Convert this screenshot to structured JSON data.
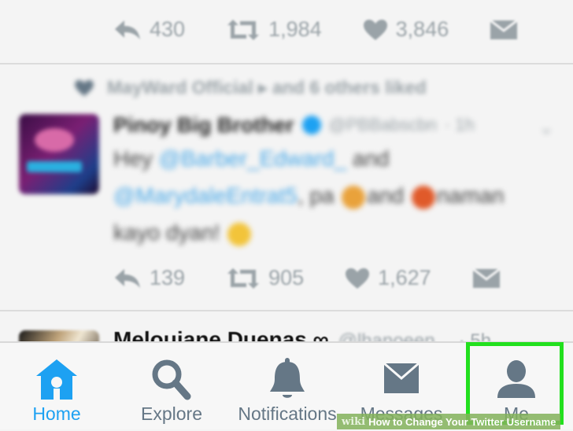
{
  "feed": {
    "top_tweet": {
      "reply_count": "430",
      "retweet_count": "1,984",
      "like_count": "3,846"
    },
    "liked_tweet": {
      "liked_by": "MayWard Official ▸ and 6 others liked",
      "author_name": "Pinoy Big Brother",
      "author_handle": "@PBBabscbn",
      "time": "· 1h",
      "text_1": "Hey ",
      "mention_1": "@Barber_Edward_",
      "text_2": " and",
      "mention_2": "@MarydaleEntrat5",
      "text_3": ", pa ",
      "text_4": "and ",
      "text_5": "naman",
      "text_6": "kayo dyan! ",
      "reply_count": "139",
      "retweet_count": "905",
      "like_count": "1,627"
    },
    "next_tweet": {
      "author_name": "Melouiane Duenas ∞",
      "author_handle": "@lhanoeen",
      "time": "· 5h"
    }
  },
  "tabbar": {
    "home": "Home",
    "explore": "Explore",
    "notifications": "Notifications",
    "messages": "Messages",
    "me": "Me",
    "active_tab": "home",
    "active_color": "#1da1f2",
    "inactive_color": "#657786"
  },
  "highlight_color": "#22e01e",
  "watermark": {
    "brand": "wiki",
    "title": "How to Change Your Twitter Username"
  },
  "icons": [
    "reply-icon",
    "retweet-icon",
    "heart-icon",
    "direct-message-icon",
    "home-icon",
    "search-icon",
    "bell-icon",
    "envelope-icon",
    "person-icon"
  ]
}
